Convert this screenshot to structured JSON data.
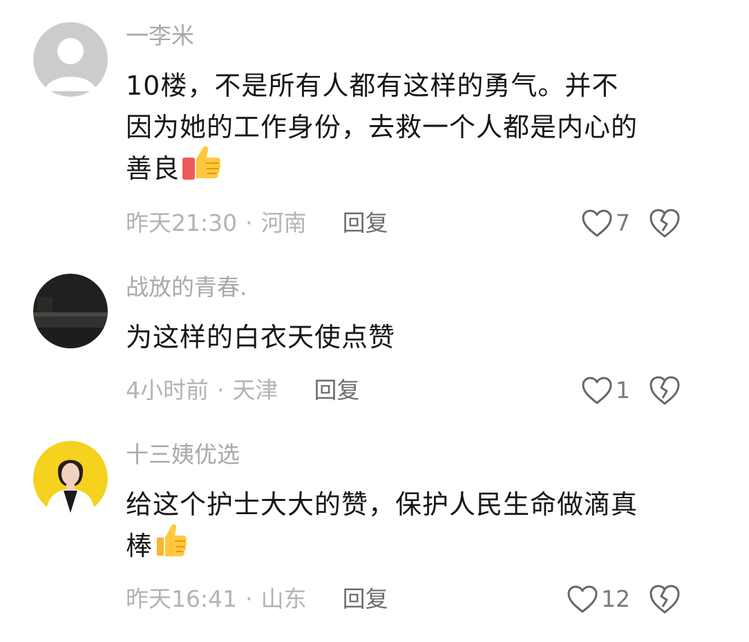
{
  "comments": [
    {
      "username": "一李米",
      "lines": [
        "10楼，不是所有人都有这样的勇气。并不",
        "因为她的工作身份，去救一个人都是内心的",
        "善良"
      ],
      "emoji": "thumbs-up-icon",
      "time": "昨天21:30",
      "separator": "·",
      "location": "河南",
      "reply": "回复",
      "likes": "7"
    },
    {
      "username": "战放的青春.",
      "lines": [
        "为这样的白衣天使点赞"
      ],
      "time": "4小时前",
      "separator": "·",
      "location": "天津",
      "reply": "回复",
      "likes": "1"
    },
    {
      "username": "十三姨优选",
      "lines": [
        "给这个护士大大的赞，保护人民生命做滴真",
        "棒"
      ],
      "emoji": "thumbs-up-icon",
      "time": "昨天16:41",
      "separator": "·",
      "location": "山东",
      "reply": "回复",
      "likes": "12"
    }
  ],
  "colors": {
    "username": "#a9a9a9",
    "text": "#161616",
    "meta": "#b3b3b3",
    "reply": "#6c6c6c",
    "avatar_yellow_bg": "#f4d21d"
  }
}
